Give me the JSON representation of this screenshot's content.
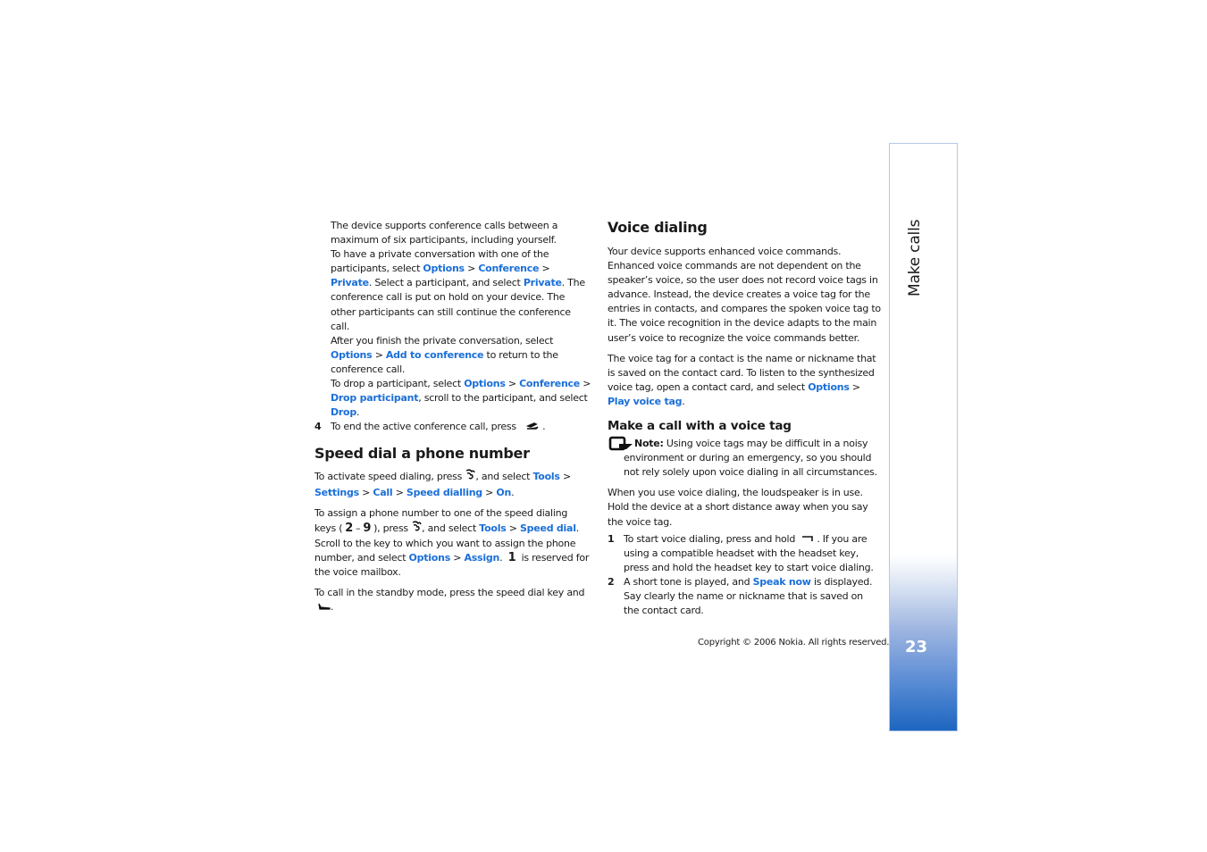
{
  "sidetab": {
    "title": "Make calls",
    "page_number": "23"
  },
  "footer": {
    "copyright": "Copyright © 2006 Nokia. All rights reserved."
  },
  "left": {
    "conf_p1": "The device supports conference calls between a maximum of six participants, including yourself.",
    "conf_p2_a": "To have a private conversation with one of the participants, select ",
    "options": "Options",
    "conference": "Conference",
    "private": "Private",
    "sep": " > ",
    "conf_p2_b": "Select a participant, and select ",
    "conf_p2_c": ". The conference call is put on hold on your device. The other participants can still continue the conference call.",
    "conf_p3_a": "After you finish the private conversation, select ",
    "add_to_conference": "Add to conference",
    "conf_p3_b": " to return to the conference call.",
    "conf_p4_a": "To drop a participant, select ",
    "drop_participant": "Drop participant",
    "conf_p4_b": ", scroll to the participant, and select ",
    "drop": "Drop",
    "step4_num": "4",
    "step4_text": "To end the active conference call, press",
    "speed_heading": "Speed dial a phone number",
    "speed_p1_a": "To activate speed dialing, press ",
    "speed_p1_b": ", and select ",
    "tools": "Tools",
    "settings": "Settings",
    "call": "Call",
    "speed_dialling": "Speed dialling",
    "on": "On",
    "speed_p2_a": "To assign a phone number to one of the speed dialing keys (",
    "key_2": "2",
    "key_dash": "–",
    "key_9": "9",
    "speed_p2_b": "), press ",
    "speed_p2_c": ", and select ",
    "speed_dial": "Speed dial",
    "speed_p2_d": ". Scroll to the key to which you want to assign the phone number, and select ",
    "assign": "Assign",
    "key_1": "1",
    "speed_p2_e": " is reserved for the voice mailbox.",
    "speed_p3": "To call in the standby mode, press the speed dial key and"
  },
  "right": {
    "voice_heading": "Voice dialing",
    "voice_p1": "Your device supports enhanced voice commands. Enhanced voice commands are not dependent on the speaker’s voice, so the user does not record voice tags in advance. Instead, the device creates a voice tag for the entries in contacts, and compares the spoken voice tag to it. The voice recognition in the device adapts to the main user’s voice to recognize the voice commands better.",
    "voice_p2_a": "The voice tag for a contact is the name or nickname that is saved on the contact card. To listen to the synthesized voice tag, open a contact card, and select ",
    "options": "Options",
    "play_voice_tag": "Play voice tag",
    "make_call_heading": "Make a call with a voice tag",
    "note_label": "Note:",
    "note_text": " Using voice tags may be difficult in a noisy environment or during an emergency, so you should not rely solely upon voice dialing in all circumstances.",
    "voice_p3": "When you use voice dialing, the loudspeaker is in use. Hold the device at a short distance away when you say the voice tag.",
    "step1_num": "1",
    "step1_a": "To start voice dialing, press and hold ",
    "step1_b": ". If you are using a compatible headset with the headset key, press and hold the headset key to start voice dialing.",
    "step2_num": "2",
    "step2_a": "A short tone is played, and ",
    "speak_now": "Speak now",
    "step2_b": " is displayed. Say clearly the name or nickname that is saved on the contact card."
  }
}
